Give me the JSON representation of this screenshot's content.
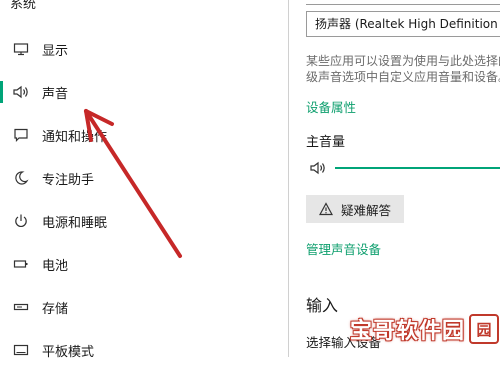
{
  "sidebar": {
    "top_label": "系统",
    "items": [
      {
        "label": "显示",
        "icon": "monitor-icon"
      },
      {
        "label": "声音",
        "icon": "speaker-icon"
      },
      {
        "label": "通知和操作",
        "icon": "notification-icon"
      },
      {
        "label": "专注助手",
        "icon": "moon-icon"
      },
      {
        "label": "电源和睡眠",
        "icon": "power-icon"
      },
      {
        "label": "电池",
        "icon": "battery-icon"
      },
      {
        "label": "存储",
        "icon": "storage-icon"
      },
      {
        "label": "平板模式",
        "icon": "tablet-icon"
      }
    ],
    "active_index": 1
  },
  "main": {
    "output_device": "扬声器 (Realtek High Definition Audio)",
    "description_line1": "某些应用可以设置为使用与此处选择的设备不同的",
    "description_line2": "级声音选项中自定义应用音量和设备。",
    "device_properties_link": "设备属性",
    "master_volume_label": "主音量",
    "troubleshoot_button": "疑难解答",
    "manage_devices_link": "管理声音设备",
    "input_heading": "输入",
    "select_input_label": "选择输入设备"
  },
  "watermark": {
    "text": "宝哥软件园",
    "seal": "园"
  },
  "colors": {
    "accent": "#00a478",
    "link": "#0e9f6e",
    "annotation_arrow": "#c62828"
  }
}
